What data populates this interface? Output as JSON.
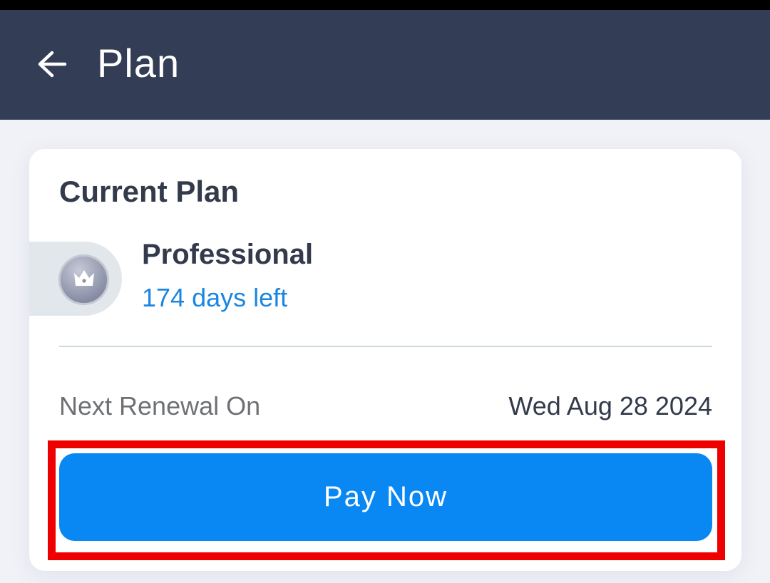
{
  "header": {
    "title": "Plan",
    "back_icon": "arrow-left-icon"
  },
  "card": {
    "heading": "Current Plan",
    "plan": {
      "icon": "crown-icon",
      "name": "Professional",
      "days_left": "174 days left"
    },
    "renewal": {
      "label": "Next Renewal On",
      "date": "Wed Aug 28 2024"
    },
    "pay_button_label": "Pay Now"
  },
  "colors": {
    "app_bar": "#343d56",
    "accent": "#0987f2",
    "days_left": "#1a86e0",
    "highlight": "#ee0000"
  }
}
